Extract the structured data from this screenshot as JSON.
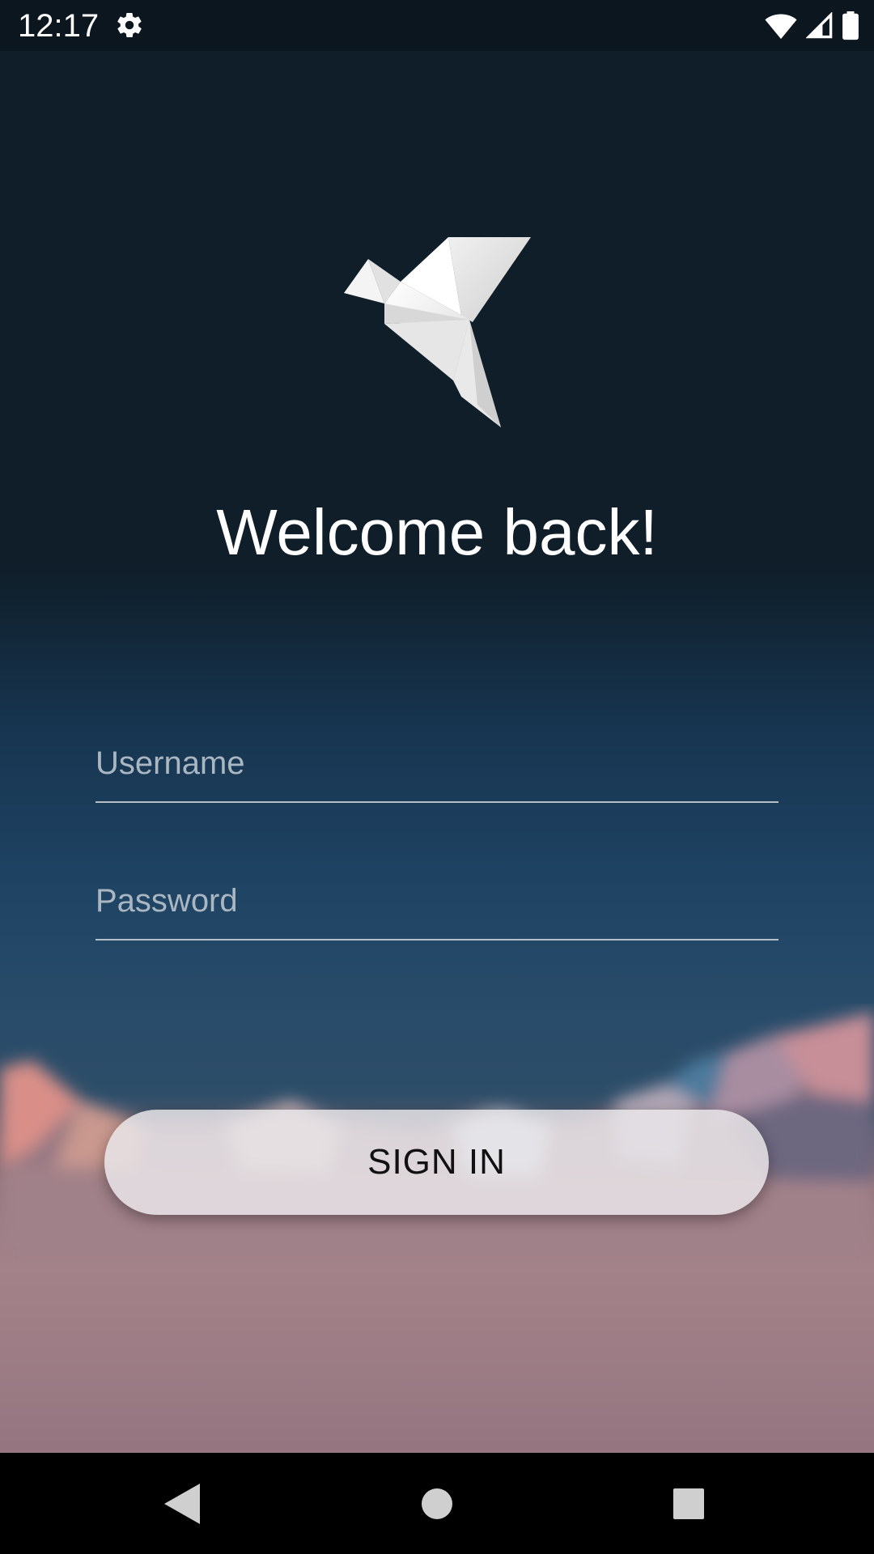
{
  "status_bar": {
    "time": "12:17",
    "icons": [
      "settings-icon",
      "wifi-icon",
      "signal-icon",
      "battery-icon"
    ]
  },
  "login": {
    "logo_icon": "origami-bird-icon",
    "title": "Welcome back!",
    "username_placeholder": "Username",
    "username_value": "",
    "password_placeholder": "Password",
    "password_value": "",
    "signin_label": "SIGN IN"
  },
  "nav_bar": {
    "icons": [
      "back-icon",
      "home-icon",
      "recents-icon"
    ]
  },
  "colors": {
    "status_bar_bg": "#0b161e",
    "text": "#ffffff",
    "placeholder": "#aab7c2",
    "button_bg": "#ece9ec",
    "button_text": "#111111"
  }
}
